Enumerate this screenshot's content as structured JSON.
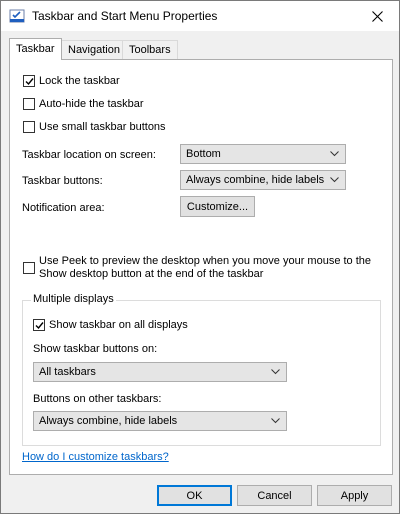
{
  "window": {
    "title": "Taskbar and Start Menu Properties"
  },
  "tabs": [
    "Taskbar",
    "Navigation",
    "Toolbars"
  ],
  "checkboxes": {
    "lock": {
      "label": "Lock the taskbar",
      "checked": true
    },
    "autohide": {
      "label": "Auto-hide the taskbar",
      "checked": false
    },
    "small_buttons": {
      "label": "Use small taskbar buttons",
      "checked": false
    }
  },
  "settings": {
    "location_label": "Taskbar location on screen:",
    "location_value": "Bottom",
    "buttons_label": "Taskbar buttons:",
    "buttons_value": "Always combine, hide labels",
    "notification_label": "Notification area:",
    "customize_label": "Customize..."
  },
  "peek": {
    "line1": "Use Peek to preview the desktop when you move your mouse to the",
    "line2": "Show desktop button at the end of the taskbar",
    "checked": false
  },
  "multiple_displays": {
    "legend": "Multiple displays",
    "show_all": {
      "label": "Show taskbar on all displays",
      "checked": true
    },
    "show_buttons_on_label": "Show taskbar buttons on:",
    "show_buttons_on_value": "All taskbars",
    "other_taskbars_label": "Buttons on other taskbars:",
    "other_taskbars_value": "Always combine, hide labels"
  },
  "help_link": "How do I customize taskbars?",
  "footer": {
    "ok": "OK",
    "cancel": "Cancel",
    "apply": "Apply"
  },
  "icons": {
    "app": "taskbar-properties-icon",
    "close": "close-icon",
    "check": "checkmark-icon",
    "dropdown": "chevron-down-icon"
  },
  "colors": {
    "accent": "#0078d7",
    "link": "#0066cc"
  }
}
